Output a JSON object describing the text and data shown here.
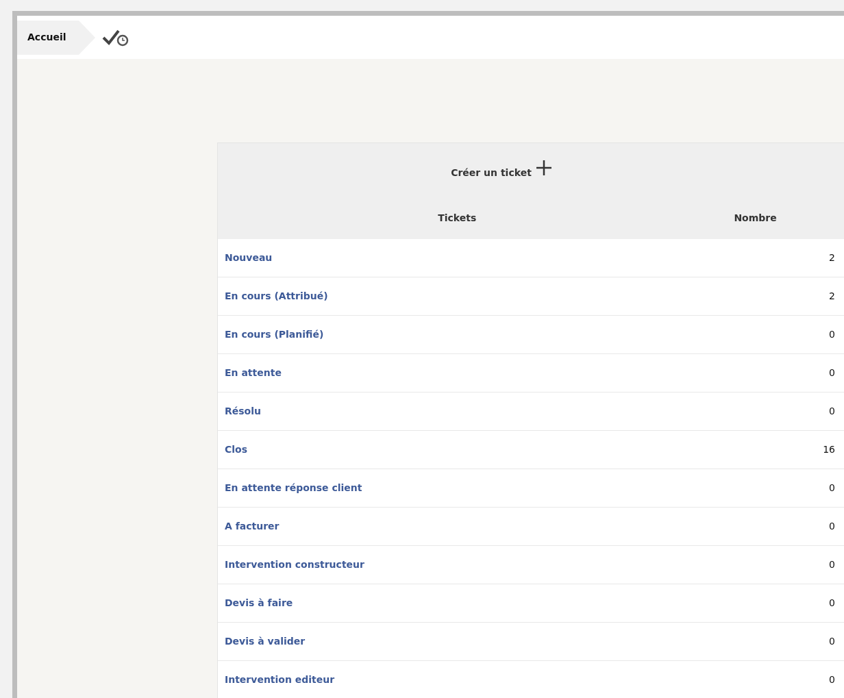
{
  "breadcrumb": {
    "label": "Accueil"
  },
  "table": {
    "create_label": "Créer un ticket",
    "columns": [
      "Tickets",
      "Nombre"
    ],
    "rows": [
      {
        "status": "Nouveau",
        "count": "2"
      },
      {
        "status": "En cours (Attribué)",
        "count": "2"
      },
      {
        "status": "En cours (Planifié)",
        "count": "0"
      },
      {
        "status": "En attente",
        "count": "0"
      },
      {
        "status": "Résolu",
        "count": "0"
      },
      {
        "status": "Clos",
        "count": "16"
      },
      {
        "status": "En attente réponse client",
        "count": "0"
      },
      {
        "status": "A facturer",
        "count": "0"
      },
      {
        "status": "Intervention constructeur",
        "count": "0"
      },
      {
        "status": "Devis à faire",
        "count": "0"
      },
      {
        "status": "Devis à valider",
        "count": "0"
      },
      {
        "status": "Intervention editeur",
        "count": "0"
      }
    ]
  }
}
